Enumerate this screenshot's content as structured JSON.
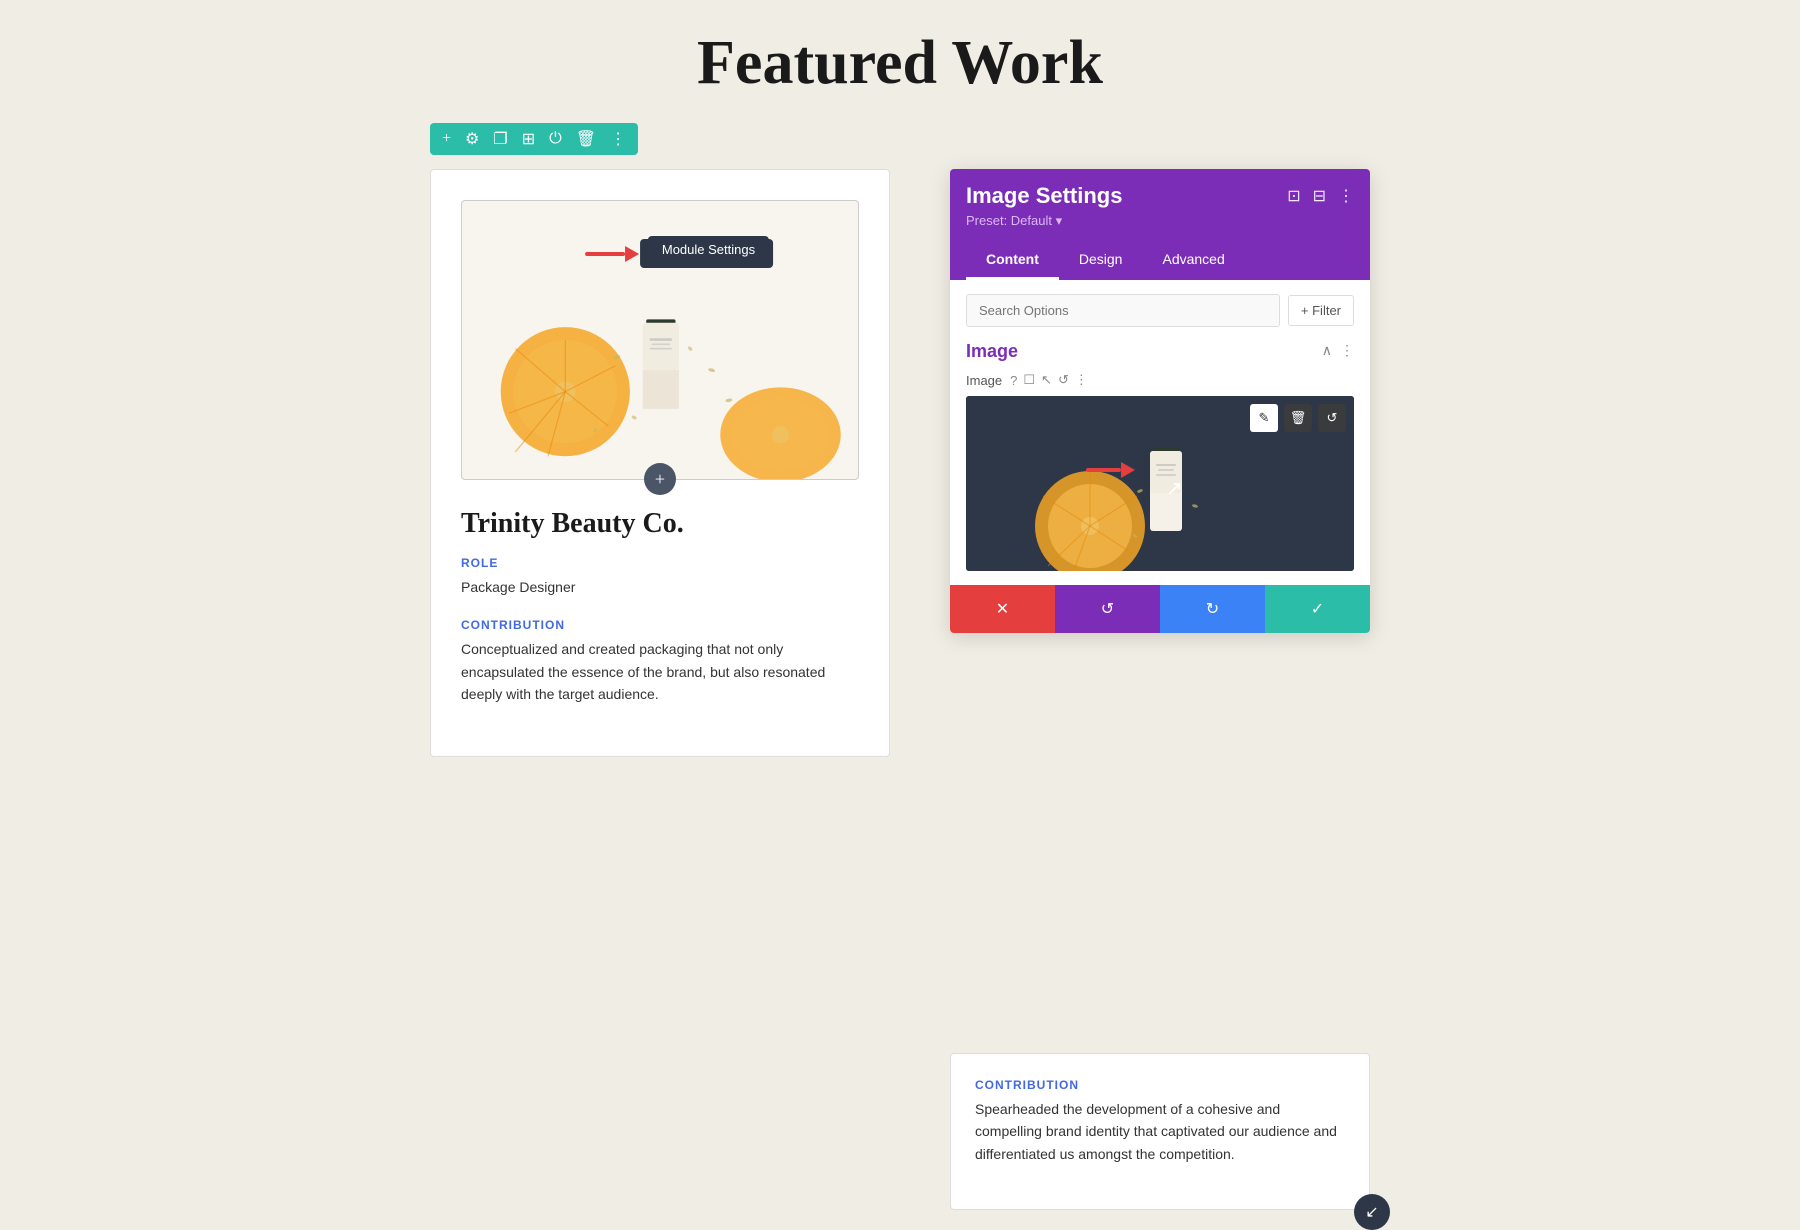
{
  "page": {
    "title": "Featured Work",
    "background_color": "#f0ede4"
  },
  "module_toolbar": {
    "icons": [
      "plus",
      "gear",
      "copy",
      "grid",
      "power",
      "trash",
      "more"
    ]
  },
  "tooltip": {
    "text": "Module Settings"
  },
  "left_card": {
    "title": "Trinity Beauty Co.",
    "role_label": "ROLE",
    "role_value": "Package Designer",
    "contribution_label": "CONTRIBUTION",
    "contribution_text": "Conceptualized and created packaging that not only encapsulated the essence of the brand, but also resonated deeply with the target audience."
  },
  "image_settings_panel": {
    "header_title": "Image Settings",
    "preset_label": "Preset: Default",
    "tabs": [
      "Content",
      "Design",
      "Advanced"
    ],
    "active_tab": "Content",
    "search_placeholder": "Search Options",
    "filter_label": "+ Filter",
    "section_title": "Image",
    "image_row_label": "Image",
    "image_row_icons": [
      "question",
      "phone",
      "cursor",
      "undo",
      "more"
    ]
  },
  "action_bar": {
    "cancel_icon": "✕",
    "undo_icon": "↺",
    "redo_icon": "↻",
    "confirm_icon": "✓"
  },
  "right_card": {
    "contribution_label": "CONTRIBUTION",
    "contribution_text": "Spearheaded the development of a cohesive and compelling brand identity that captivated our audience and differentiated us amongst the competition."
  }
}
